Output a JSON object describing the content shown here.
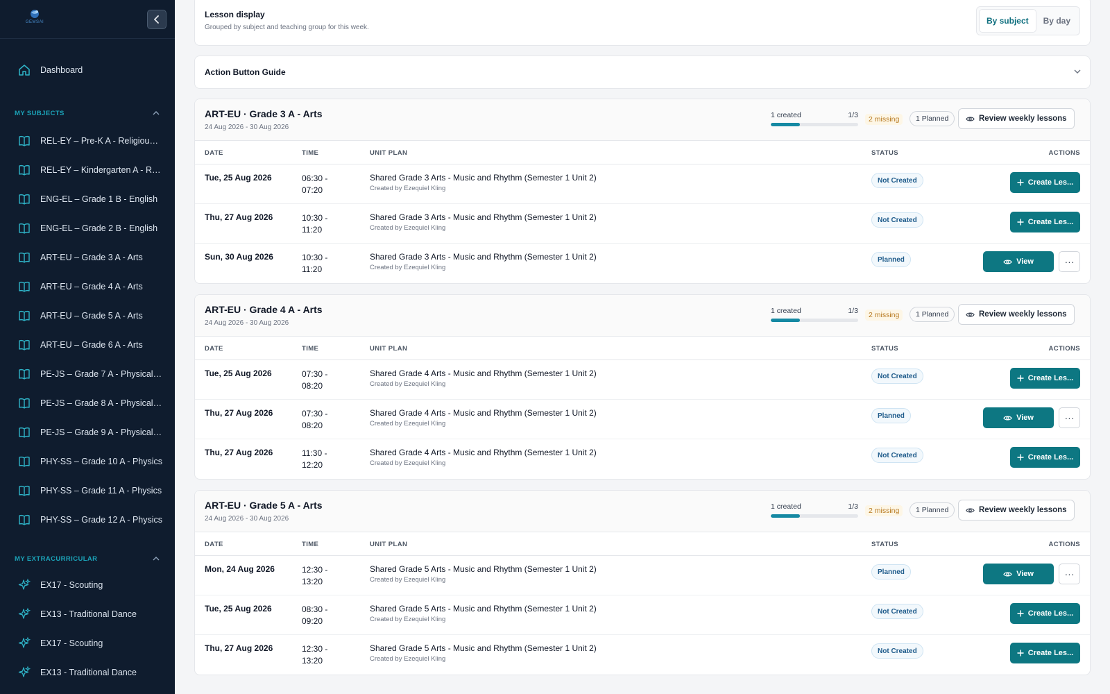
{
  "sidebar": {
    "logo_text": "GEMSAI",
    "collapse_label": "‹",
    "dashboard": "Dashboard",
    "subjects_header": "MY SUBJECTS",
    "subjects": [
      "REL-EY – Pre-K A - Religious a...",
      "REL-EY – Kindergarten A - Reli...",
      "ENG-EL – Grade 1 B - English",
      "ENG-EL – Grade 2 B - English",
      "ART-EU – Grade 3 A - Arts",
      "ART-EU – Grade 4 A - Arts",
      "ART-EU – Grade 5 A - Arts",
      "ART-EU – Grade 6 A - Arts",
      "PE-JS – Grade 7 A - Physical E...",
      "PE-JS – Grade 8 A - Physical E...",
      "PE-JS – Grade 9 A - Physical E...",
      "PHY-SS – Grade 10 A - Physics",
      "PHY-SS – Grade 11 A - Physics",
      "PHY-SS – Grade 12 A - Physics"
    ],
    "extra_header": "MY EXTRACURRICULAR",
    "extracurricular": [
      "EX17 - Scouting",
      "EX13 - Traditional Dance",
      "EX17 - Scouting",
      "EX13 - Traditional Dance"
    ]
  },
  "lesson_display": {
    "title": "Lesson display",
    "subtitle": "Grouped by subject and teaching group for this week.",
    "options": [
      "By subject",
      "By day"
    ],
    "active": "By subject"
  },
  "guide": {
    "title": "Action Button Guide"
  },
  "table_headers": {
    "date": "DATE",
    "time": "TIME",
    "unit": "UNIT PLAN",
    "status": "STATUS",
    "actions": "ACTIONS"
  },
  "labels": {
    "review": "Review weekly lessons",
    "create": "Create Les...",
    "view": "View",
    "more": "···"
  },
  "colors": {
    "sidebar_bg": "#0f1c2e",
    "accent": "#0d7782",
    "section_header": "#1ba3b8"
  },
  "groups": [
    {
      "title": "ART-EU · Grade 3 A - Arts",
      "dates": "24 Aug 2026 - 30 Aug 2026",
      "created": "1 created",
      "ratio": "1/3",
      "progress": 0.333,
      "missing": "2 missing",
      "planned": "1 Planned",
      "rows": [
        {
          "date": "Tue, 25 Aug 2026",
          "time": "06:30 - 07:20",
          "unit": "Shared Grade 3 Arts - Music and Rhythm (Semester 1 Unit 2)",
          "by": "Created by Ezequiel Kling",
          "status": "Not Created",
          "action": "create"
        },
        {
          "date": "Thu, 27 Aug 2026",
          "time": "10:30 - 11:20",
          "unit": "Shared Grade 3 Arts - Music and Rhythm (Semester 1 Unit 2)",
          "by": "Created by Ezequiel Kling",
          "status": "Not Created",
          "action": "create"
        },
        {
          "date": "Sun, 30 Aug 2026",
          "time": "10:30 - 11:20",
          "unit": "Shared Grade 3 Arts - Music and Rhythm (Semester 1 Unit 2)",
          "by": "Created by Ezequiel Kling",
          "status": "Planned",
          "action": "view"
        }
      ]
    },
    {
      "title": "ART-EU · Grade 4 A - Arts",
      "dates": "24 Aug 2026 - 30 Aug 2026",
      "created": "1 created",
      "ratio": "1/3",
      "progress": 0.333,
      "missing": "2 missing",
      "planned": "1 Planned",
      "rows": [
        {
          "date": "Tue, 25 Aug 2026",
          "time": "07:30 - 08:20",
          "unit": "Shared Grade 4 Arts - Music and Rhythm (Semester 1 Unit 2)",
          "by": "Created by Ezequiel Kling",
          "status": "Not Created",
          "action": "create"
        },
        {
          "date": "Thu, 27 Aug 2026",
          "time": "07:30 - 08:20",
          "unit": "Shared Grade 4 Arts - Music and Rhythm (Semester 1 Unit 2)",
          "by": "Created by Ezequiel Kling",
          "status": "Planned",
          "action": "view"
        },
        {
          "date": "Thu, 27 Aug 2026",
          "time": "11:30 - 12:20",
          "unit": "Shared Grade 4 Arts - Music and Rhythm (Semester 1 Unit 2)",
          "by": "Created by Ezequiel Kling",
          "status": "Not Created",
          "action": "create"
        }
      ]
    },
    {
      "title": "ART-EU · Grade 5 A - Arts",
      "dates": "24 Aug 2026 - 30 Aug 2026",
      "created": "1 created",
      "ratio": "1/3",
      "progress": 0.333,
      "missing": "2 missing",
      "planned": "1 Planned",
      "rows": [
        {
          "date": "Mon, 24 Aug 2026",
          "time": "12:30 - 13:20",
          "unit": "Shared Grade 5 Arts - Music and Rhythm (Semester 1 Unit 2)",
          "by": "Created by Ezequiel Kling",
          "status": "Planned",
          "action": "view"
        },
        {
          "date": "Tue, 25 Aug 2026",
          "time": "08:30 - 09:20",
          "unit": "Shared Grade 5 Arts - Music and Rhythm (Semester 1 Unit 2)",
          "by": "Created by Ezequiel Kling",
          "status": "Not Created",
          "action": "create"
        },
        {
          "date": "Thu, 27 Aug 2026",
          "time": "12:30 - 13:20",
          "unit": "Shared Grade 5 Arts - Music and Rhythm (Semester 1 Unit 2)",
          "by": "Created by Ezequiel Kling",
          "status": "Not Created",
          "action": "create"
        }
      ]
    }
  ]
}
